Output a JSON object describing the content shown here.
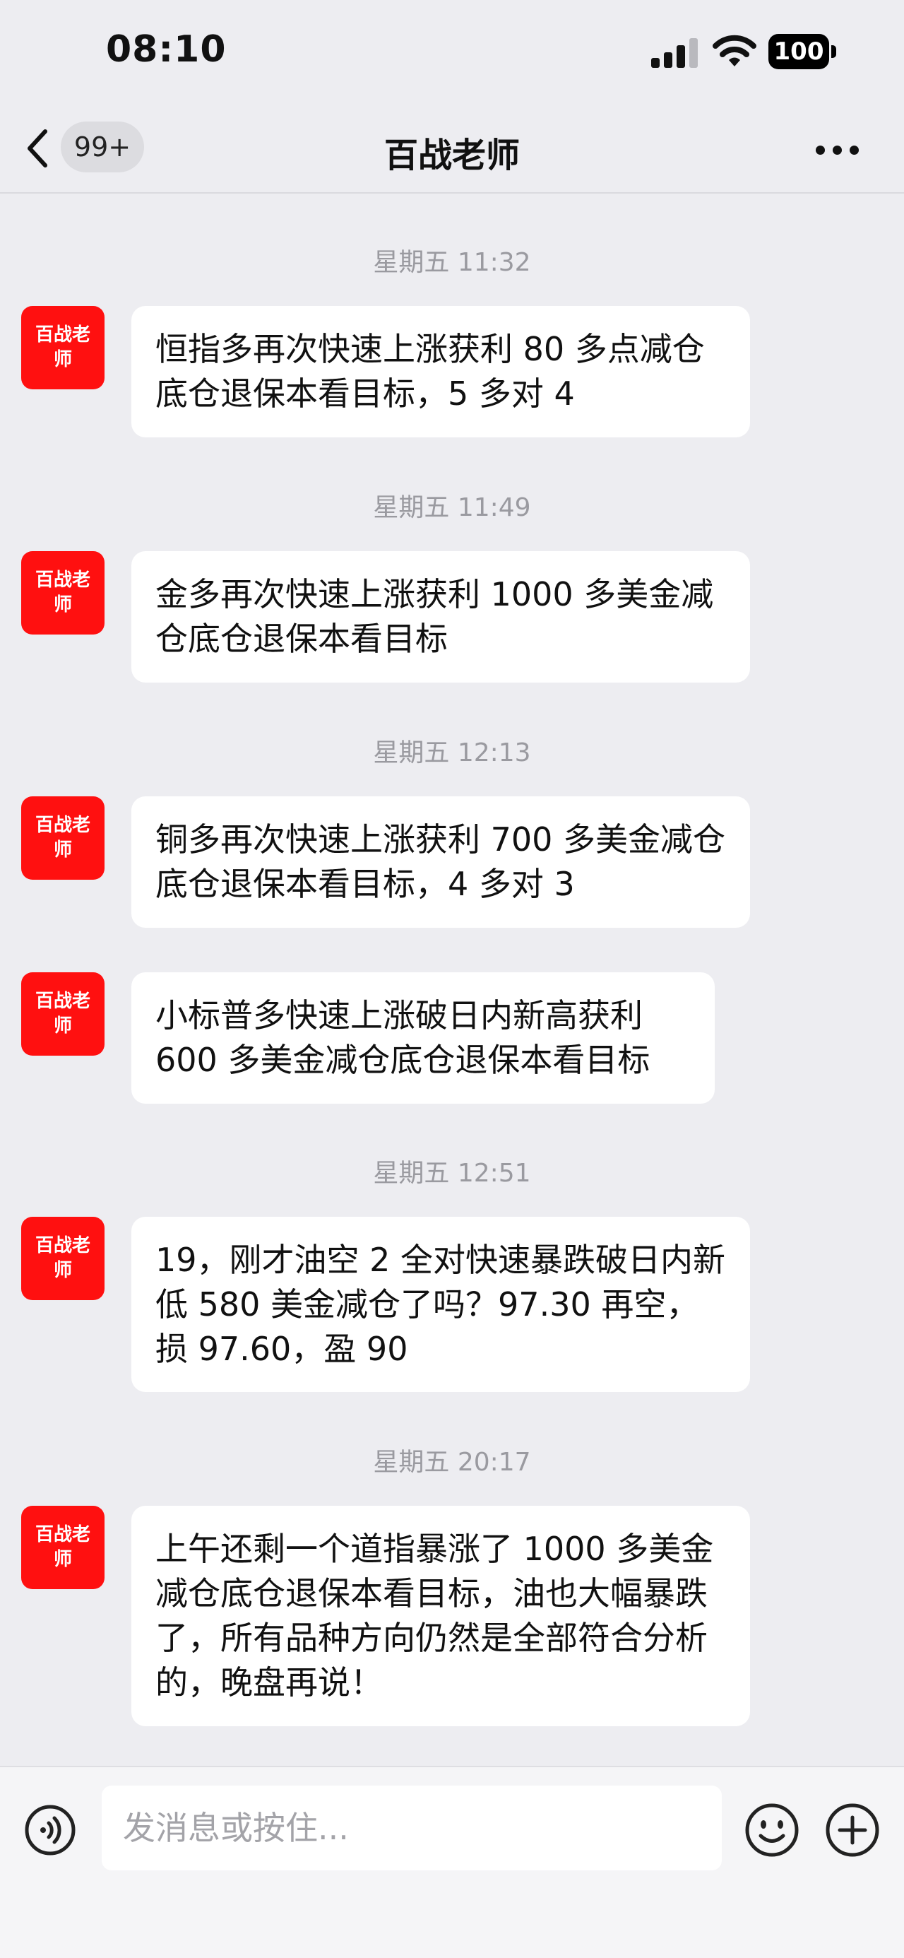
{
  "status_bar": {
    "time": "08:10",
    "battery": "100"
  },
  "header": {
    "back_badge": "99+",
    "title": "百战老师"
  },
  "avatar_label": "百战老师",
  "messages": [
    {
      "timestamp": "星期五 11:32",
      "text": "恒指多再次快速上涨获利 80 多点减仓底仓退保本看目标，5 多对 4"
    },
    {
      "timestamp": "星期五 11:49",
      "text": "金多再次快速上涨获利 1000 多美金减仓底仓退保本看目标"
    },
    {
      "timestamp": "星期五 12:13",
      "text": "铜多再次快速上涨获利 700 多美金减仓底仓退保本看目标，4 多对 3"
    },
    {
      "timestamp": "",
      "text": "小标普多快速上涨破日内新高获利 600 多美金减仓底仓退保本看目标"
    },
    {
      "timestamp": "星期五 12:51",
      "text": "19，刚才油空 2 全对快速暴跌破日内新低 580 美金减仓了吗？97.30 再空，损 97.60，盈 90"
    },
    {
      "timestamp": "星期五 20:17",
      "text": "上午还剩一个道指暴涨了 1000 多美金减仓底仓退保本看目标，油也大幅暴跌了，所有品种方向仍然是全部符合分析的，晚盘再说！"
    }
  ],
  "input": {
    "placeholder": "发消息或按住..."
  },
  "icons": {
    "back": "chevron-left-icon",
    "more": "more-dots-icon",
    "voice": "voice-icon",
    "emoji": "emoji-icon",
    "add": "plus-icon",
    "signal": "cellular-signal-icon",
    "wifi": "wifi-icon",
    "battery": "battery-icon"
  },
  "colors": {
    "avatar": "#ff1010",
    "background": "#ededf1",
    "bubble": "#ffffff"
  }
}
